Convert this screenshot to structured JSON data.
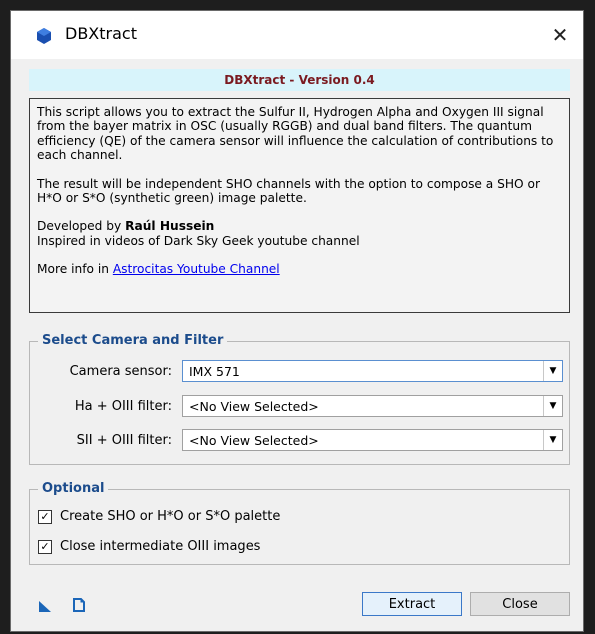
{
  "window": {
    "title": "DBXtract",
    "close_glyph": "✕"
  },
  "header": {
    "version": "DBXtract - Version 0.4"
  },
  "info": {
    "paragraph1": "This script allows you to extract the Sulfur II, Hydrogen Alpha and Oxygen III signal from the bayer matrix in OSC (usually RGGB) and dual band filters. The quantum efficiency (QE) of the camera sensor will influence the calculation of contributions to each channel.",
    "paragraph2": "The result will be independent SHO channels with the option to compose a SHO or H*O or S*O (synthetic green) image palette.",
    "developed_prefix": "Developed by ",
    "author": "Raúl Hussein",
    "inspired": "Inspired in videos of Dark Sky Geek youtube channel",
    "more_prefix": "More info in ",
    "link_text": "Astrocitas Youtube Channel"
  },
  "camera_group": {
    "title": "Select Camera and Filter",
    "rows": [
      {
        "label": "Camera sensor:",
        "value": "IMX 571"
      },
      {
        "label": "Ha + OIII filter:",
        "value": "<No View Selected>"
      },
      {
        "label": "SII + OIII filter:",
        "value": "<No View Selected>"
      }
    ]
  },
  "optional_group": {
    "title": "Optional",
    "checks": [
      {
        "label": "Create SHO or H*O or S*O palette",
        "checked": true
      },
      {
        "label": "Close intermediate OIII images",
        "checked": true
      }
    ]
  },
  "footer": {
    "extract_label": "Extract",
    "close_label": "Close",
    "icons": [
      "new-instance-icon",
      "documentation-icon"
    ]
  },
  "colors": {
    "title_bar_bg": "#ffffff",
    "version_bg": "#d8f4fb",
    "version_text": "#7a1a20",
    "group_title": "#1c4c8c",
    "link": "#0000ee",
    "icon_blue": "#1b66b8"
  }
}
